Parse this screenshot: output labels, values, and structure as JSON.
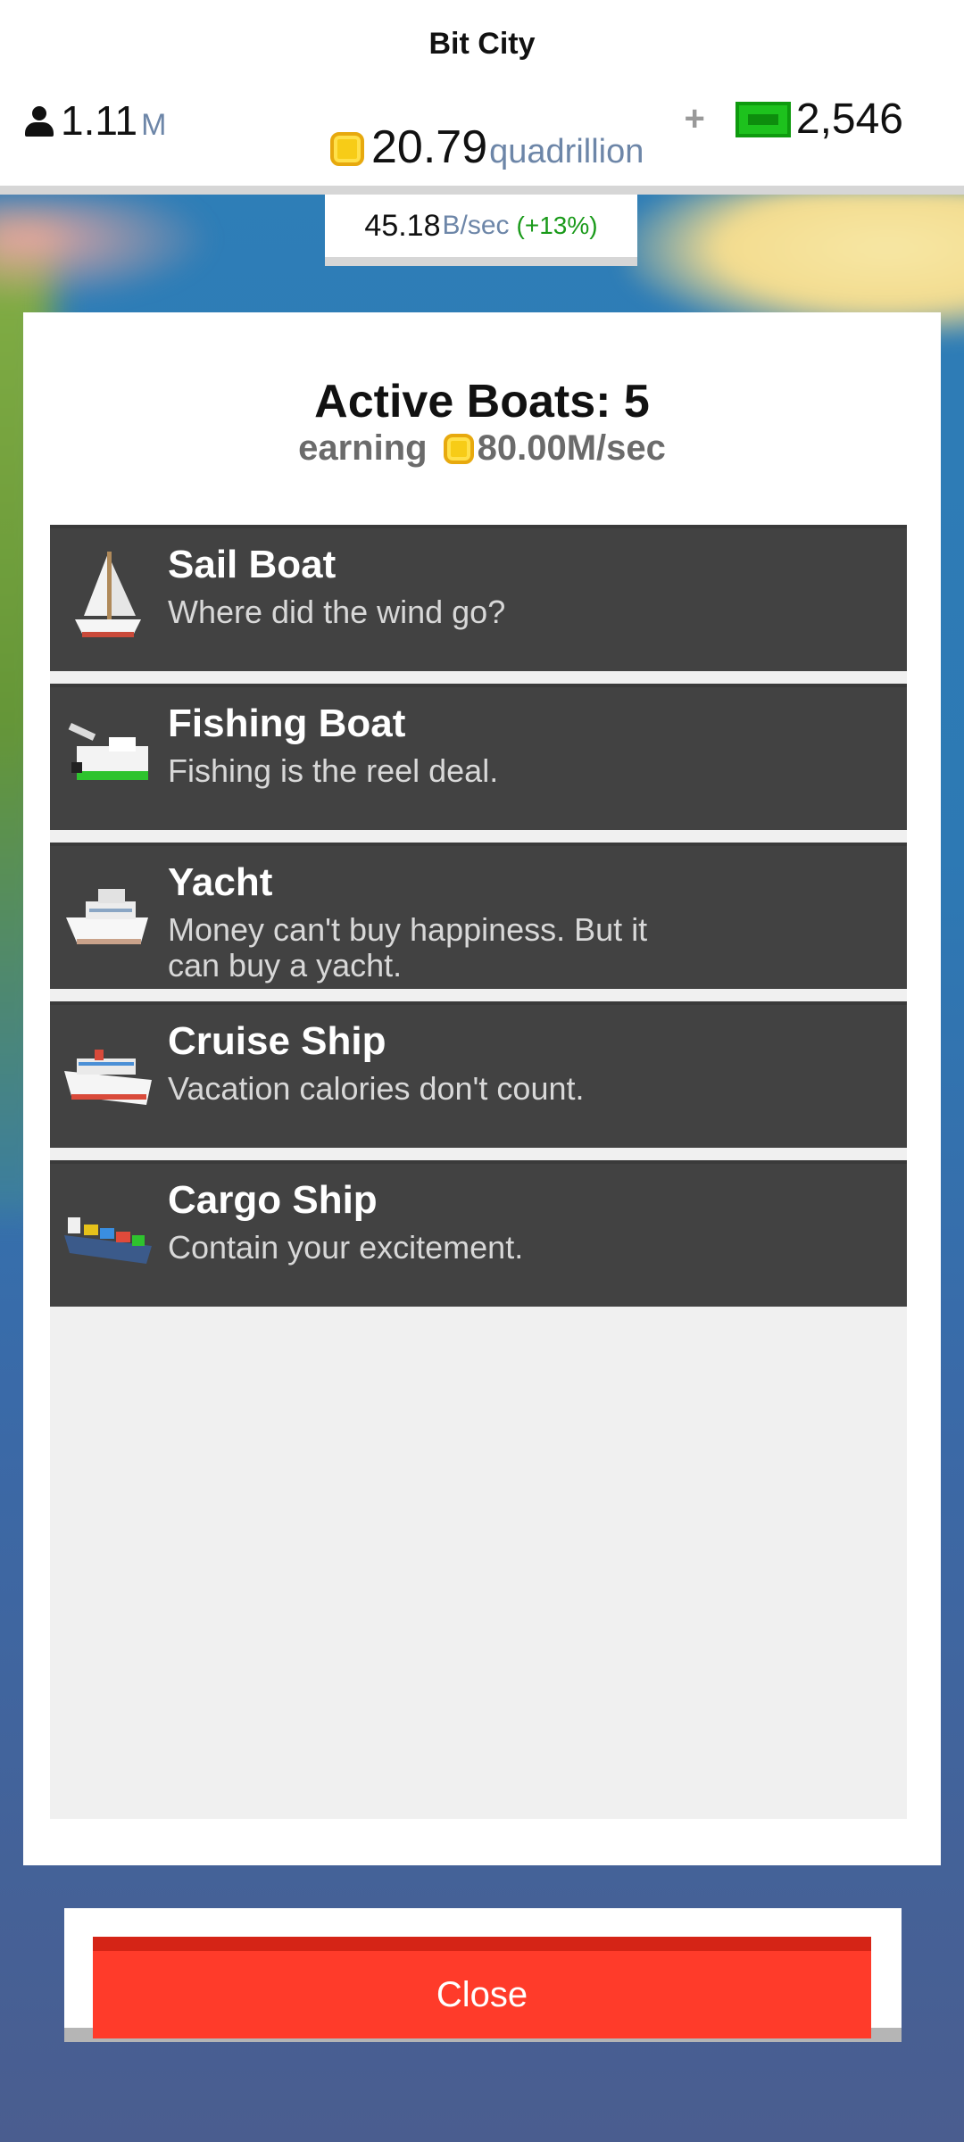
{
  "header": {
    "city_name": "Bit City",
    "population": {
      "value": "1.11",
      "unit": "M",
      "icon": "person-icon"
    },
    "coins": {
      "value": "20.79",
      "unit": "quadrillion",
      "icon": "coin-icon"
    },
    "cash": {
      "plus": "+",
      "value": "2,546",
      "icon": "cash-bill-icon"
    },
    "rate": {
      "value": "45.18",
      "unit": "B/sec",
      "percent": "(+13%)"
    }
  },
  "modal": {
    "title": "Active Boats: 5",
    "earning_label": "earning",
    "earning_value": "80.00M/sec",
    "boats": [
      {
        "name": "Sail Boat",
        "description": "Where did the wind go?",
        "icon": "sailboat-icon"
      },
      {
        "name": "Fishing Boat",
        "description": "Fishing is the reel deal.",
        "icon": "fishing-boat-icon"
      },
      {
        "name": "Yacht",
        "description": "Money can't buy happiness. But it can buy a yacht.",
        "icon": "yacht-icon"
      },
      {
        "name": "Cruise Ship",
        "description": "Vacation calories don't count.",
        "icon": "cruise-ship-icon"
      },
      {
        "name": "Cargo Ship",
        "description": "Contain your excitement.",
        "icon": "cargo-ship-icon"
      }
    ]
  },
  "close_label": "Close",
  "colors": {
    "accent_red": "#ff3b2a",
    "row_background": "#424242",
    "unit_blue": "#6d86a8",
    "rate_green": "#1a9a1a",
    "cash_green": "#1dc21d",
    "coin_gold": "#f7cc17"
  }
}
